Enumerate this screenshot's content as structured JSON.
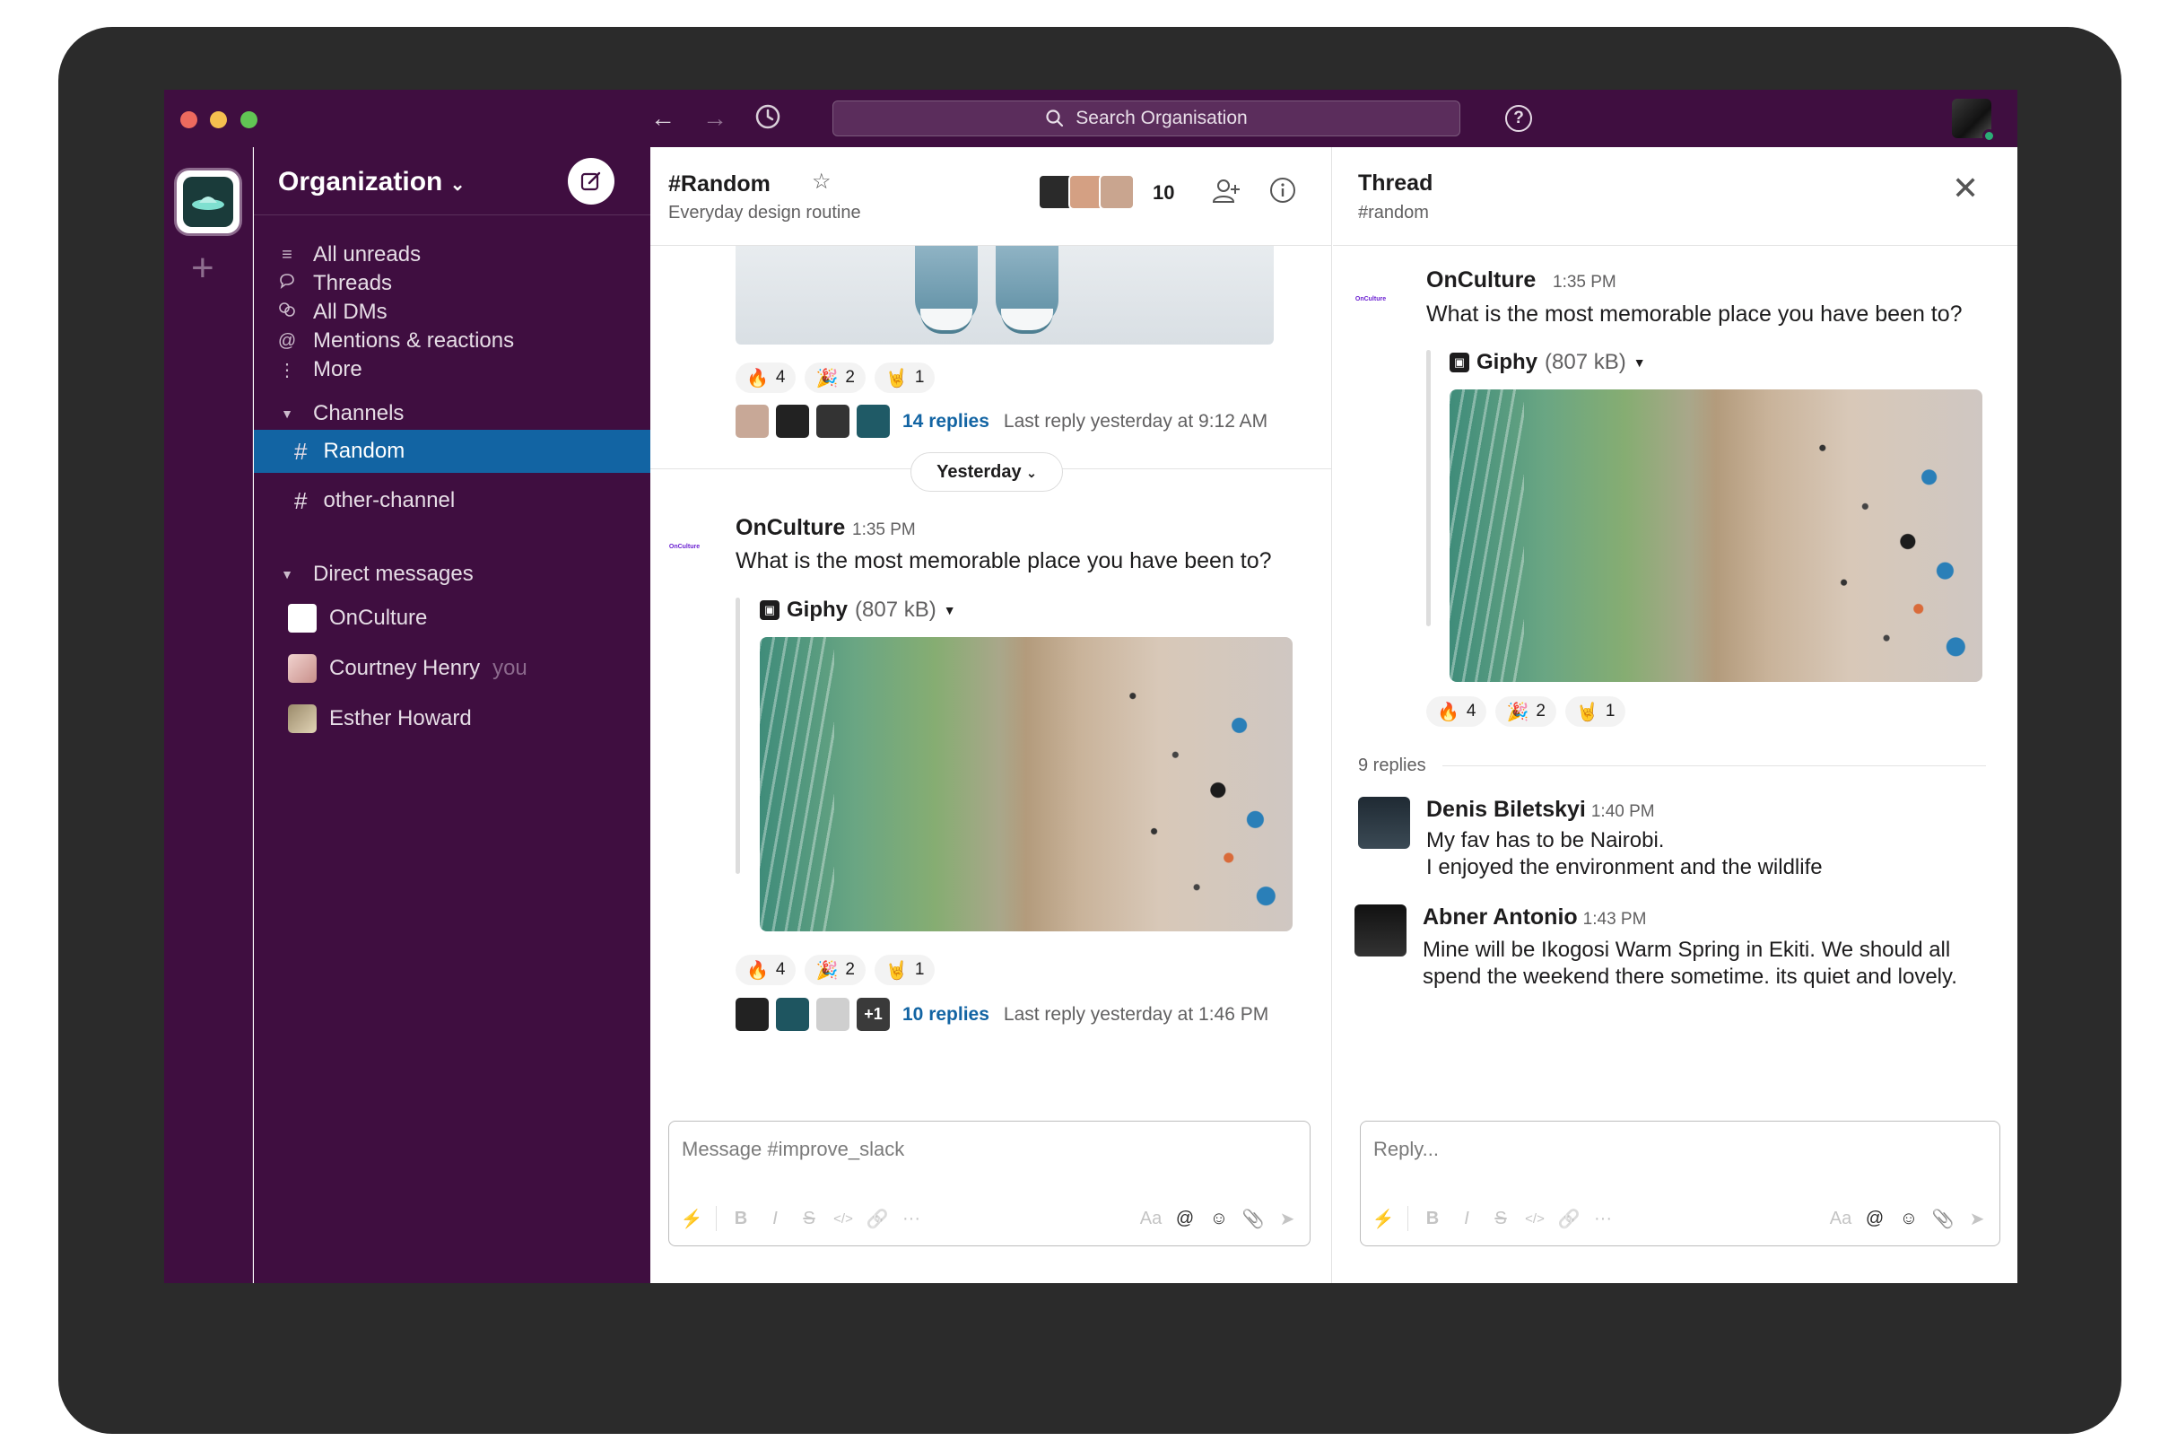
{
  "topbar": {
    "search_placeholder": "Search Organisation",
    "back_icon": "arrow-left-icon",
    "forward_icon": "arrow-right-icon",
    "history_icon": "clock-icon",
    "help_icon": "question-icon"
  },
  "sidebar": {
    "org_name": "Organization",
    "nav": [
      {
        "label": "All unreads",
        "icon": "list-icon"
      },
      {
        "label": "Threads",
        "icon": "speech-bubble-icon"
      },
      {
        "label": "All DMs",
        "icon": "dm-bubbles-icon"
      },
      {
        "label": "Mentions & reactions",
        "icon": "at-icon"
      },
      {
        "label": "More",
        "icon": "kebab-icon"
      }
    ],
    "channels_header": "Channels",
    "channels": [
      {
        "label": "Random",
        "active": true
      },
      {
        "label": "other-channel",
        "active": false
      }
    ],
    "dms_header": "Direct messages",
    "dms": [
      {
        "label": "OnCulture",
        "suffix": ""
      },
      {
        "label": "Courtney Henry",
        "suffix": "you"
      },
      {
        "label": "Esther Howard",
        "suffix": ""
      }
    ]
  },
  "channel": {
    "title": "#Random",
    "subtitle": "Everyday design routine",
    "member_count": "10",
    "top_reactions": [
      {
        "emoji": "🔥",
        "count": "4"
      },
      {
        "emoji": "🎉",
        "count": "2"
      },
      {
        "emoji": "🤘",
        "count": "1"
      }
    ],
    "top_replies": {
      "link": "14 replies",
      "meta": "Last reply yesterday at 9:12 AM"
    },
    "day_divider": "Yesterday",
    "message": {
      "logo_text": "OnCulture",
      "author": "OnCulture",
      "time": "1:35 PM",
      "text": "What is the most memorable place you have been to?",
      "attachment_name": "Giphy",
      "attachment_size": "(807 kB)"
    },
    "msg_reactions": [
      {
        "emoji": "🔥",
        "count": "4"
      },
      {
        "emoji": "🎉",
        "count": "2"
      },
      {
        "emoji": "🤘",
        "count": "1"
      }
    ],
    "msg_replies": {
      "more": "+1",
      "link": "10 replies",
      "meta": "Last reply yesterday at 1:46 PM"
    },
    "composer_placeholder": "Message #improve_slack"
  },
  "thread": {
    "title": "Thread",
    "subtitle": "#random",
    "message": {
      "logo_text": "OnCulture",
      "author": "OnCulture",
      "time": "1:35 PM",
      "text": "What is the most memorable place you have been to?",
      "attachment_name": "Giphy",
      "attachment_size": "(807 kB)"
    },
    "reactions": [
      {
        "emoji": "🔥",
        "count": "4"
      },
      {
        "emoji": "🎉",
        "count": "2"
      },
      {
        "emoji": "🤘",
        "count": "1"
      }
    ],
    "replies_count": "9 replies",
    "replies": [
      {
        "author": "Denis Biletskyi",
        "time": "1:40 PM",
        "lines": [
          "My fav has to be Nairobi.",
          "I enjoyed the environment and the wildlife"
        ]
      },
      {
        "author": "Abner Antonio",
        "time": "1:43 PM",
        "lines": [
          "Mine will be Ikogosi Warm Spring in Ekiti. We should all",
          "spend the weekend there sometime. its quiet and lovely."
        ]
      }
    ],
    "composer_placeholder": "Reply..."
  },
  "composer_tools": {
    "shortcuts": "⚡",
    "bold": "B",
    "italic": "I",
    "strike": "S",
    "code": "</>",
    "link": "🔗",
    "more": "···",
    "format": "Aa",
    "mention": "@",
    "emoji": "☺",
    "attach": "📎",
    "send": "➤"
  },
  "colors": {
    "aubergine": "#3f0e40",
    "active_blue": "#1264a3",
    "link_blue": "#1264a3",
    "presence_green": "#2bac76"
  }
}
